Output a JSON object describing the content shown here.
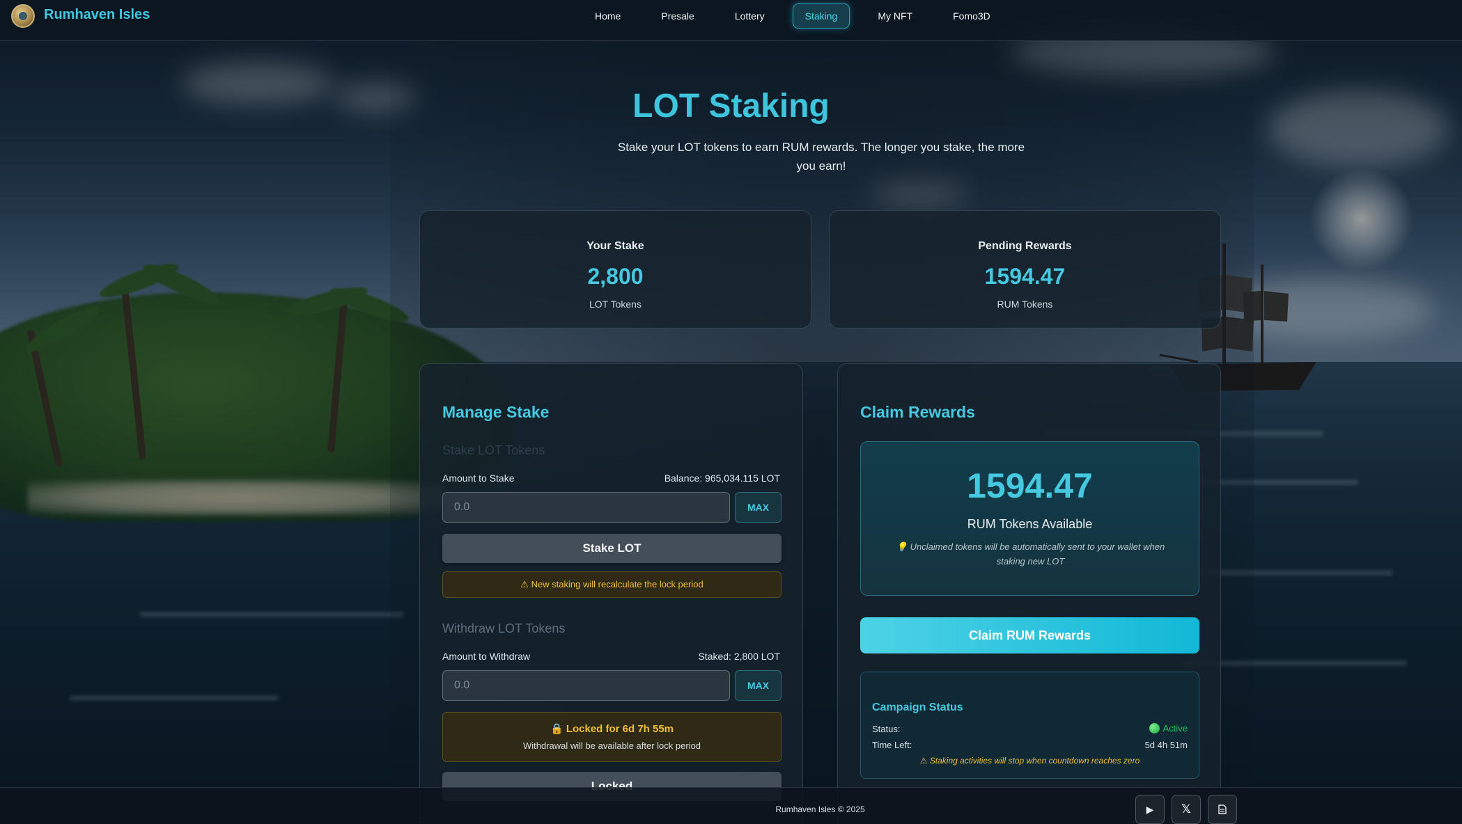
{
  "brand": {
    "name": "Rumhaven Isles"
  },
  "nav": {
    "links": [
      "Home",
      "Presale",
      "Lottery",
      "Staking",
      "My NFT",
      "Fomo3D"
    ],
    "active": "Staking"
  },
  "hero": {
    "title": "LOT Staking",
    "subtitle": "Stake your LOT tokens to earn RUM rewards. The longer you stake, the more you earn!"
  },
  "stats": {
    "stake": {
      "label": "Your Stake",
      "value": "2,800",
      "unit": "LOT Tokens"
    },
    "rewards": {
      "label": "Pending Rewards",
      "value": "1594.47",
      "unit": "RUM Tokens"
    }
  },
  "manage": {
    "title": "Manage Stake",
    "stake_section": "Stake LOT Tokens",
    "stake_amount_label": "Amount to Stake",
    "balance": "Balance: 965,034.115 LOT",
    "stake_placeholder": "0.0",
    "max_label": "MAX",
    "stake_button": "Stake LOT",
    "stake_warning": "New staking will recalculate the lock period",
    "withdraw_section": "Withdraw LOT Tokens",
    "withdraw_amount_label": "Amount to Withdraw",
    "staked": "Staked: 2,800 LOT",
    "withdraw_placeholder": "0.0",
    "lock_title": "Locked for 6d 7h 55m",
    "lock_note": "Withdrawal will be available after lock period",
    "locked_button": "Locked"
  },
  "claim": {
    "title": "Claim Rewards",
    "amount": "1594.47",
    "amount_unit": "RUM Tokens Available",
    "note": "Unclaimed tokens will be automatically sent to your wallet when staking new LOT",
    "button": "Claim RUM Rewards",
    "campaign": {
      "title": "Campaign Status",
      "status_label": "Status:",
      "status_value": "Active",
      "time_label": "Time Left:",
      "time_value": "5d 4h 51m",
      "warning": "Staking activities will stop when countdown reaches zero"
    }
  },
  "footer": {
    "copyright": "Rumhaven Isles © 2025"
  },
  "colors": {
    "accent": "#45c8e0",
    "warning": "#efbf34",
    "active": "#22c55e",
    "claim_gradient_start": "#4dd2e6",
    "claim_gradient_end": "#12b8d6"
  },
  "icons": {
    "footer": [
      "play-icon",
      "x-icon",
      "document-icon"
    ],
    "warning": "warning-icon",
    "lock": "lock-icon",
    "lightbulb": "lightbulb-icon",
    "status_dot": "green-dot-icon"
  }
}
